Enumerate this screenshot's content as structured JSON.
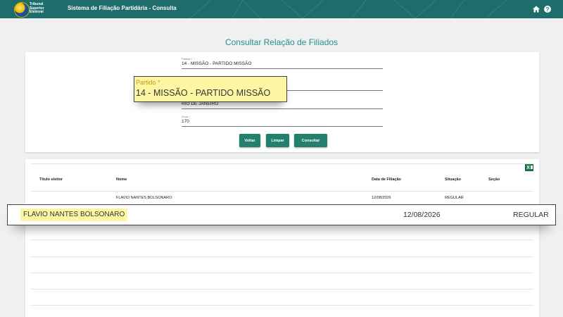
{
  "header": {
    "logo_text": [
      "Tribunal",
      "Superior",
      "Eleitoral"
    ],
    "app_title": "Sistema de Filiação Partidária - Consulta",
    "colors": {
      "bar": "#1f6d6b",
      "accent": "#23806f"
    }
  },
  "page_title": "Consultar Relação de Filiados",
  "form": {
    "partido": {
      "label": "Partido *",
      "value": "14 - MISSÃO - PARTIDO MISSÃO"
    },
    "municipio": {
      "value": "RIO DE JANEIRO"
    },
    "zona": {
      "label": "Zona *",
      "value": "170"
    },
    "buttons": {
      "voltar": "Voltar",
      "limpar": "Limpar",
      "consultar": "Consultar"
    }
  },
  "zoom_partido": {
    "label": "Partido *",
    "value": "14 - MISSÃO - PARTIDO MISSÃO"
  },
  "table": {
    "columns": [
      "Título eleitor",
      "Nome",
      "Data de Filiação",
      "Situação",
      "Seção"
    ],
    "rows": [
      {
        "titulo": "",
        "nome": "FLAVIO NANTES BOLSONARO",
        "data": "12/08/2026",
        "situacao": "REGULAR",
        "secao": ""
      }
    ]
  },
  "zoom_row": {
    "nome": "FLAVIO NANTES BOLSONARO",
    "data": "12/08/2026",
    "situacao": "REGULAR"
  }
}
